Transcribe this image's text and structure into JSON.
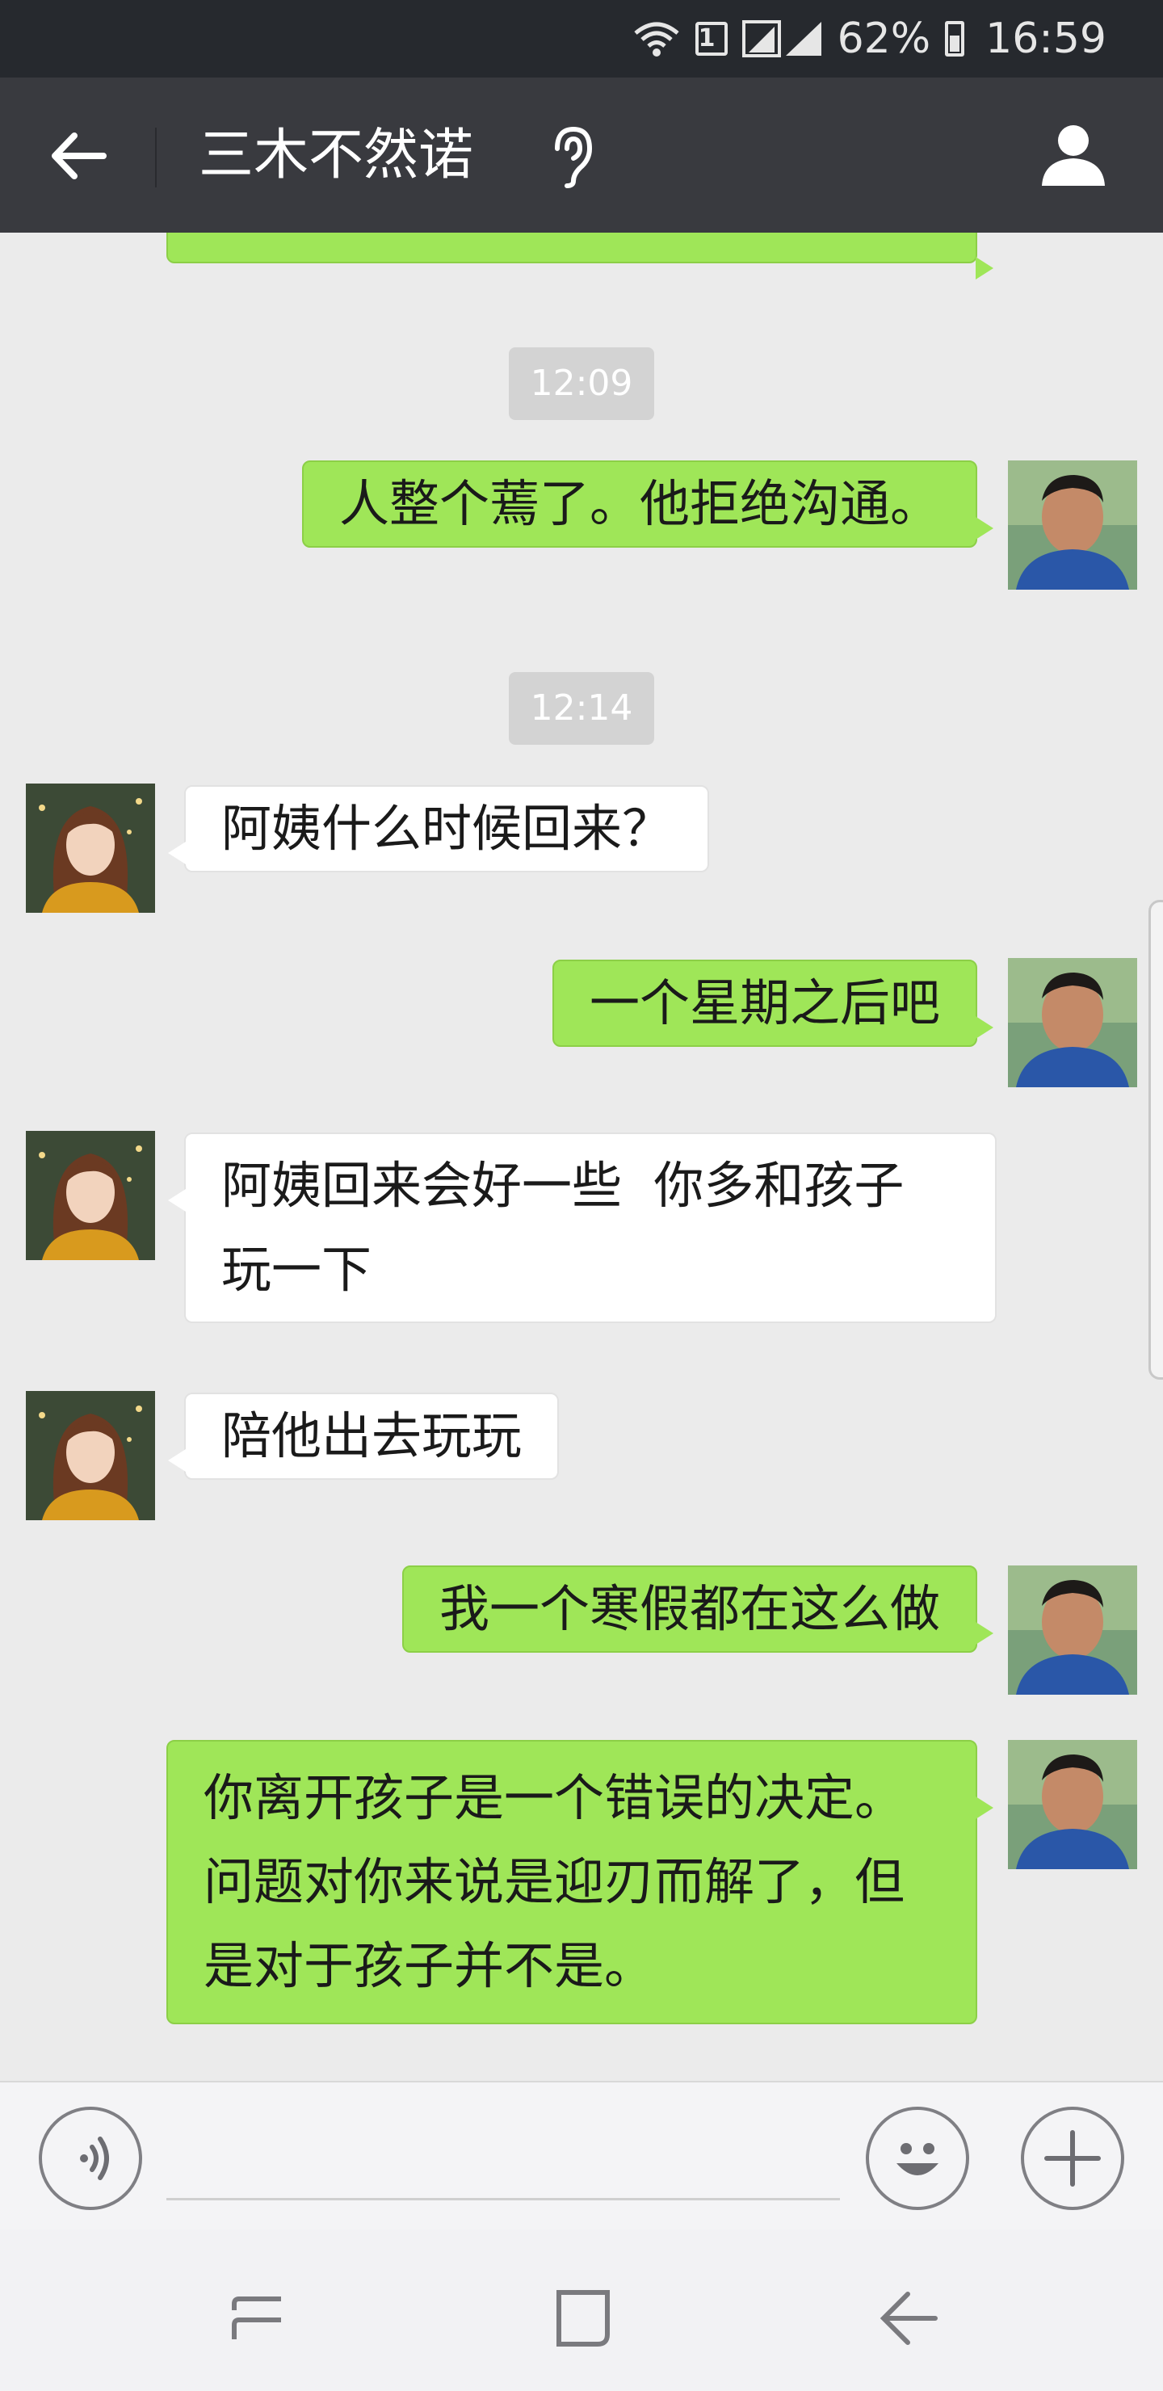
{
  "status_bar": {
    "sim_slot": "1",
    "battery": "62%",
    "time": "16:59"
  },
  "header": {
    "title": "三木不然诺"
  },
  "messages": [
    {
      "type": "time",
      "text": "12:09"
    },
    {
      "type": "sent",
      "text": "人整个蔫了。他拒绝沟通。"
    },
    {
      "type": "time",
      "text": "12:14"
    },
    {
      "type": "recv",
      "text": "阿姨什么时候回来？"
    },
    {
      "type": "sent",
      "text": "一个星期之后吧"
    },
    {
      "type": "recv",
      "text": "阿姨回来会好一些  你多和孩子\n玩一下"
    },
    {
      "type": "recv",
      "text": "陪他出去玩玩"
    },
    {
      "type": "sent",
      "text": "我一个寒假都在这么做"
    },
    {
      "type": "sent",
      "text": "你离开孩子是一个错误的决定。\n问题对你来说是迎刃而解了，但\n是对于孩子并不是。"
    }
  ],
  "input": {
    "value": "",
    "voice_icon": "voice-icon",
    "emoji_icon": "emoji-icon",
    "plus_icon": "plus-icon"
  },
  "colors": {
    "sent_bubble": "#9fe658",
    "recv_bubble": "#ffffff",
    "header_bg": "#393a3f",
    "status_bg": "#26292e",
    "chat_bg": "#ebebeb"
  }
}
